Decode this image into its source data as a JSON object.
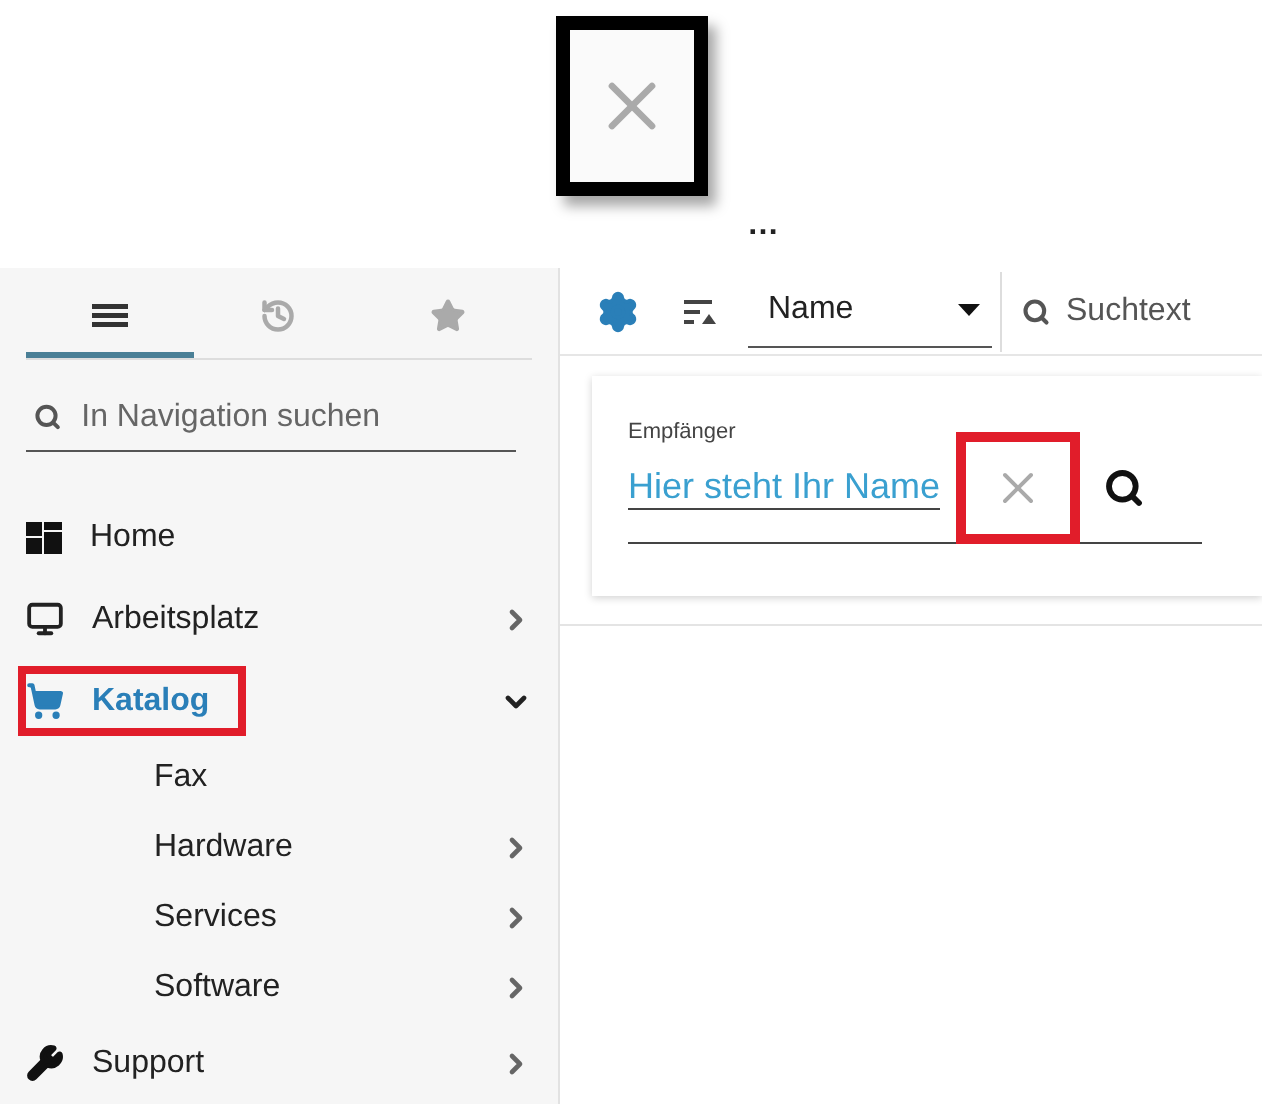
{
  "preview": {
    "caption": "…"
  },
  "sidebar": {
    "tabs": [
      {
        "selected": true
      },
      {
        "selected": false
      },
      {
        "selected": false
      }
    ],
    "search": {
      "placeholder": "In Navigation suchen"
    },
    "items": [
      {
        "label": "Home",
        "highlighted": false,
        "has_submenu": false
      },
      {
        "label": "Arbeitsplatz",
        "highlighted": false,
        "has_submenu": true,
        "expanded": false
      },
      {
        "label": "Katalog",
        "highlighted": true,
        "has_submenu": true,
        "expanded": true,
        "children": [
          {
            "label": "Fax",
            "has_submenu": false
          },
          {
            "label": "Hardware",
            "has_submenu": true
          },
          {
            "label": "Services",
            "has_submenu": true
          },
          {
            "label": "Software",
            "has_submenu": true
          }
        ]
      },
      {
        "label": "Support",
        "highlighted": false,
        "has_submenu": true,
        "expanded": false
      }
    ]
  },
  "toolbar": {
    "sort_field": {
      "value": "Name"
    },
    "search": {
      "placeholder": "Suchtext"
    }
  },
  "recipient": {
    "label": "Empfänger",
    "value": "Hier steht Ihr Name",
    "clear_highlighted": true
  }
}
